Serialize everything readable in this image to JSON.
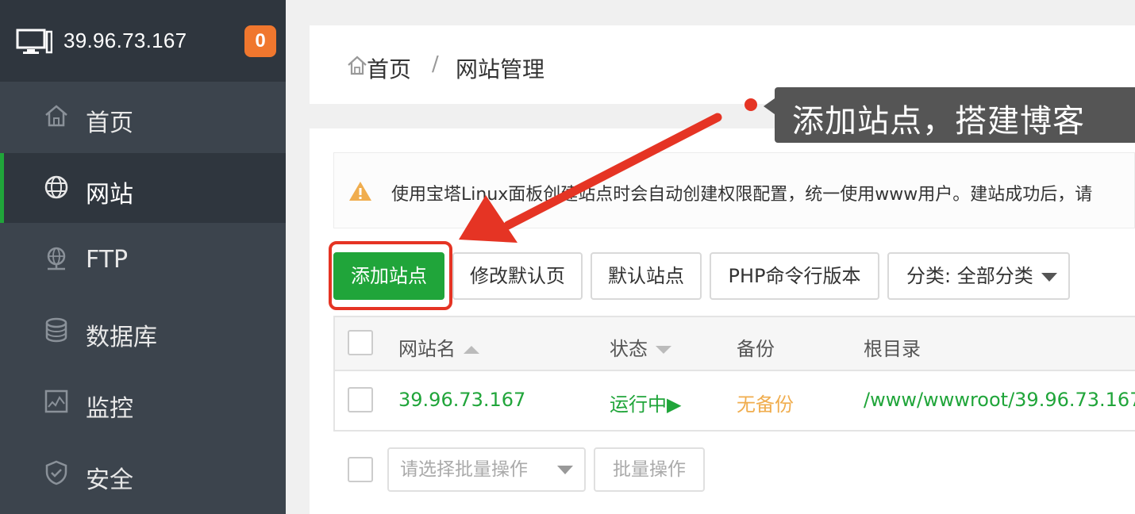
{
  "sidebar": {
    "server_ip": "39.96.73.167",
    "badge_count": "0",
    "items": [
      {
        "label": "首页",
        "icon": "home-icon"
      },
      {
        "label": "网站",
        "icon": "globe-icon",
        "active": true
      },
      {
        "label": "FTP",
        "icon": "ftp-icon"
      },
      {
        "label": "数据库",
        "icon": "database-icon"
      },
      {
        "label": "监控",
        "icon": "monitor-chart-icon"
      },
      {
        "label": "安全",
        "icon": "shield-icon"
      }
    ]
  },
  "breadcrumb": {
    "home": "首页",
    "separator": "/",
    "current": "网站管理"
  },
  "notice": {
    "text": "使用宝塔Linux面板创建站点时会自动创建权限配置，统一使用www用户。建站成功后，请"
  },
  "toolbar": {
    "add_site": "添加站点",
    "edit_default_page": "修改默认页",
    "default_site": "默认站点",
    "php_cli_version": "PHP命令行版本",
    "category_select": "分类: 全部分类"
  },
  "table": {
    "headers": {
      "name": "网站名",
      "status": "状态",
      "backup": "备份",
      "root": "根目录"
    },
    "rows": [
      {
        "name": "39.96.73.167",
        "status": "运行中▶",
        "backup": "无备份",
        "root": "/www/wwwroot/39.96.73.167"
      }
    ]
  },
  "batch": {
    "select_placeholder": "请选择批量操作",
    "button": "批量操作"
  },
  "annotation": {
    "callout": "添加站点，搭建博客"
  },
  "colors": {
    "accent_green": "#20a53a",
    "sidebar_bg": "#3c444d",
    "badge_orange": "#f0772e",
    "annotation_red": "#e53424"
  }
}
